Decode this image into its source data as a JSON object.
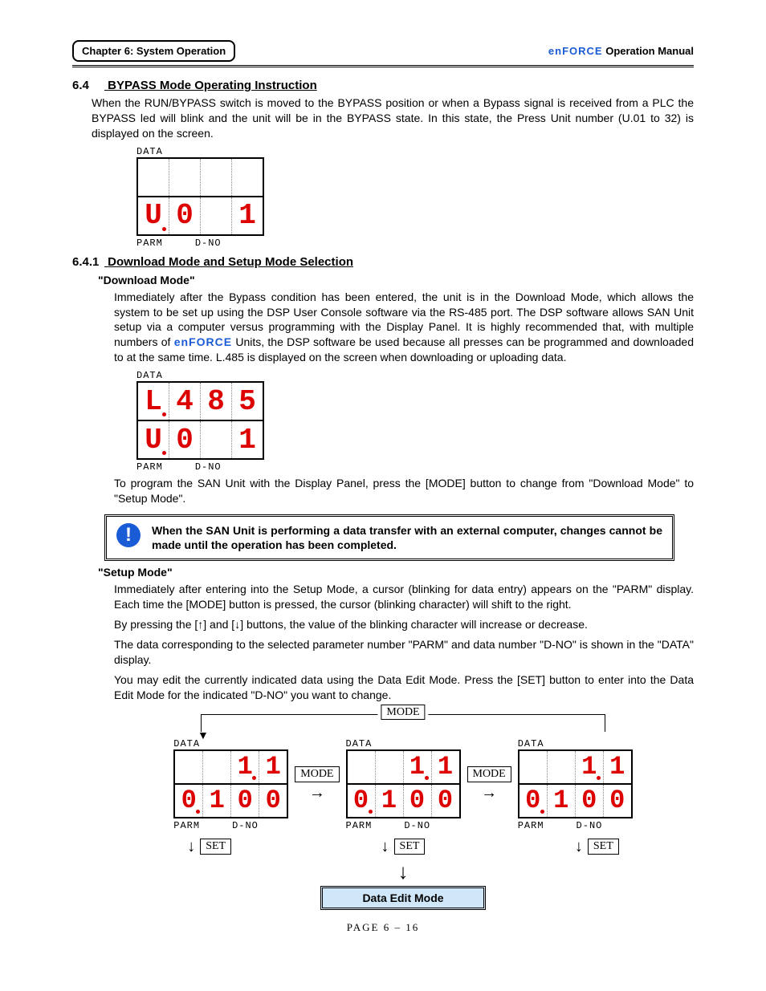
{
  "header": {
    "chapter": "Chapter 6: System Operation",
    "brand": "enFORCE",
    "manual": "Operation Manual"
  },
  "section": {
    "num": "6.4",
    "title": "BYPASS Mode Operating Instruction"
  },
  "para1": "When the RUN/BYPASS switch is moved to the BYPASS position or when a Bypass signal is received from a PLC the BYPASS led will blink and the unit will be in the BYPASS state. In this state, the Press Unit number (U.01 to 32) is displayed on the screen.",
  "display1": {
    "labels": {
      "data": "DATA",
      "parm": "PARM",
      "dno": "D-NO"
    },
    "top": [
      "",
      "",
      "",
      ""
    ],
    "bottom": [
      "U",
      "0",
      "",
      "1"
    ],
    "dotAfter": 0
  },
  "subsection": {
    "num": "6.4.1",
    "title": "Download Mode and Setup Mode Selection"
  },
  "dl": {
    "heading": "\"Download Mode\"",
    "p1a": "Immediately after the Bypass condition has been entered, the unit is in the Download Mode, which allows the system to be set up using the DSP User Console software via the RS-485 port. The DSP software allows SAN Unit setup via a computer versus programming with the Display Panel. It is highly recommended that, with multiple numbers of ",
    "p1b": " Units, the DSP software be used because all presses can be programmed and downloaded to at the same time. L.485 is displayed on the screen when downloading or uploading data."
  },
  "display2": {
    "top": [
      "L",
      "4",
      "8",
      "5"
    ],
    "bottom": [
      "U",
      "0",
      "",
      "1"
    ],
    "dotTop": 0,
    "dotBottom": 0
  },
  "para3": "To program the SAN Unit with the Display Panel, press the [MODE] button to change from \"Download Mode\" to \"Setup Mode\".",
  "note": "When the SAN Unit is performing a data transfer with an external computer, changes cannot be made until the operation has been completed.",
  "setup": {
    "heading": "\"Setup Mode\"",
    "p1": "Immediately after entering into the Setup Mode, a cursor (blinking for data entry) appears on the \"PARM\" display. Each time the [MODE] button is pressed, the cursor (blinking character) will shift to the right.",
    "p2": "By pressing the [↑] and [↓] buttons, the value of the blinking character will increase or decrease.",
    "p3": "The data corresponding to the selected parameter number \"PARM\" and data number \"D-NO\" is shown in the \"DATA\" display.",
    "p4": "You may edit the currently indicated data using the Data Edit Mode. Press the [SET] button to enter into the Data Edit Mode for the indicated \"D-NO\" you want to change."
  },
  "flow": {
    "mode": "MODE",
    "set": "SET",
    "editMode": "Data Edit Mode",
    "panels": [
      {
        "top": [
          "",
          "",
          "1",
          "1"
        ],
        "bottom": [
          "0",
          "1",
          "0",
          "0"
        ],
        "dotTop": 2,
        "dotBot": 0
      },
      {
        "top": [
          "",
          "",
          "1",
          "1"
        ],
        "bottom": [
          "0",
          "1",
          "0",
          "0"
        ],
        "dotTop": 2,
        "dotBot": 0
      },
      {
        "top": [
          "",
          "",
          "1",
          "1"
        ],
        "bottom": [
          "0",
          "1",
          "0",
          "0"
        ],
        "dotTop": 2,
        "dotBot": 0
      }
    ]
  },
  "footer": "PAGE  6 – 16"
}
